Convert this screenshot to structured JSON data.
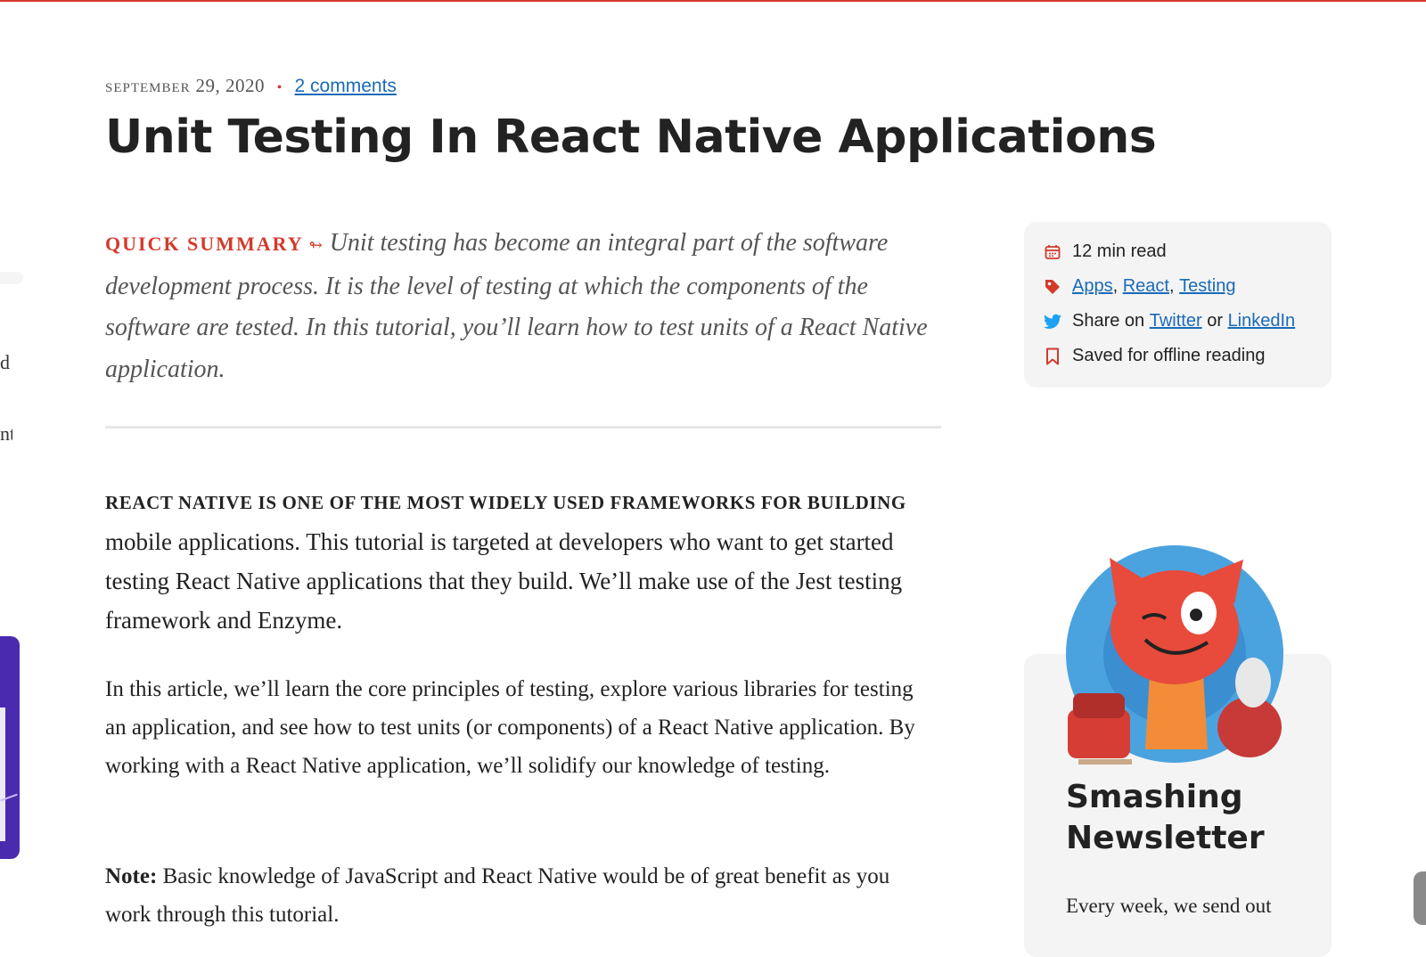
{
  "colors": {
    "accent": "#d33a2c",
    "link": "#1a6ab8",
    "card_bg": "#f4f4f4"
  },
  "edge_fragments": [
    "d",
    "nt"
  ],
  "meta": {
    "date_month": "September",
    "date_rest": "29, 2020",
    "separator": "•",
    "comments_link": "2 comments"
  },
  "article": {
    "title": "Unit Testing In React Native Applications",
    "summary_label": "Quick Summary",
    "summary_arrow": "↬",
    "summary_text": "Unit testing has become an integral part of the software development process. It is the level of testing at which the components of the software are tested. In this tutorial, you’ll learn how to test units of a React Native application.",
    "lead_caps": "React Native is one of the most widely used frameworks for building",
    "lead_rest": "mobile applications. This tutorial is targeted at developers who want to get started testing React Native applications that they build. We’ll make use of the Jest testing framework and Enzyme.",
    "paragraph_2": "In this article, we’ll learn the core principles of testing, explore various libraries for testing an application, and see how to test units (or components) of a React Native application. By working with a React Native application, we’ll solidify our knowledge of testing.",
    "note_label": "Note:",
    "note_text": "Basic knowledge of JavaScript and React Native would be of great benefit as you work through this tutorial."
  },
  "info": {
    "read_time": "12 min read",
    "tags": [
      "Apps",
      "React",
      "Testing"
    ],
    "tag_sep": ",",
    "share_prefix": "Share on",
    "share_twitter": "Twitter",
    "share_or": "or",
    "share_linkedin": "LinkedIn",
    "saved": "Saved for offline reading",
    "icons": [
      "calendar-icon",
      "tag-icon",
      "twitter-icon",
      "bookmark-icon"
    ]
  },
  "newsletter": {
    "title": "Smashing Newsletter",
    "text": "Every week, we send out"
  }
}
